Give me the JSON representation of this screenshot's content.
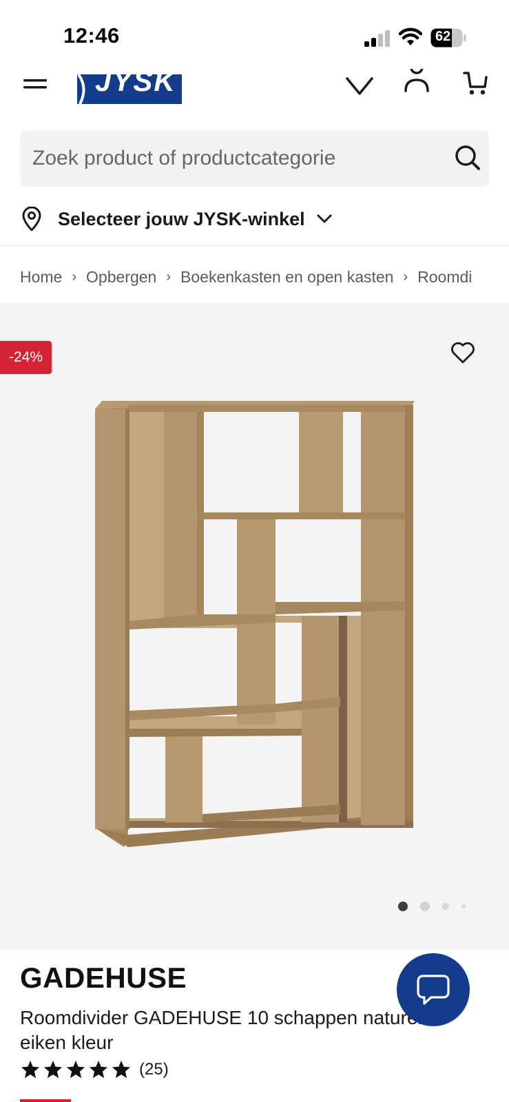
{
  "status_bar": {
    "time": "12:46",
    "battery": "62"
  },
  "header": {
    "logo_text": "JYSK",
    "brand_color": "#143c8c",
    "icons": [
      "menu-icon",
      "heart-icon",
      "user-icon",
      "cart-icon"
    ]
  },
  "search": {
    "placeholder": "Zoek product of productcategorie"
  },
  "store_selector": {
    "label": "Selecteer jouw JYSK-winkel"
  },
  "breadcrumb": {
    "items": [
      "Home",
      "Opbergen",
      "Boekenkasten en open kasten",
      "Roomdi"
    ],
    "separator": "›"
  },
  "gallery": {
    "discount": "-24%",
    "discount_color": "#d32433",
    "image_count": 4,
    "active_image_index": 0
  },
  "product": {
    "brand": "GADEHUSE",
    "description": "Roomdivider GADEHUSE 10 schappen naturel eiken kleur",
    "rating": 5,
    "review_count": "(25)"
  },
  "chat": {
    "icon": "chat-icon"
  }
}
